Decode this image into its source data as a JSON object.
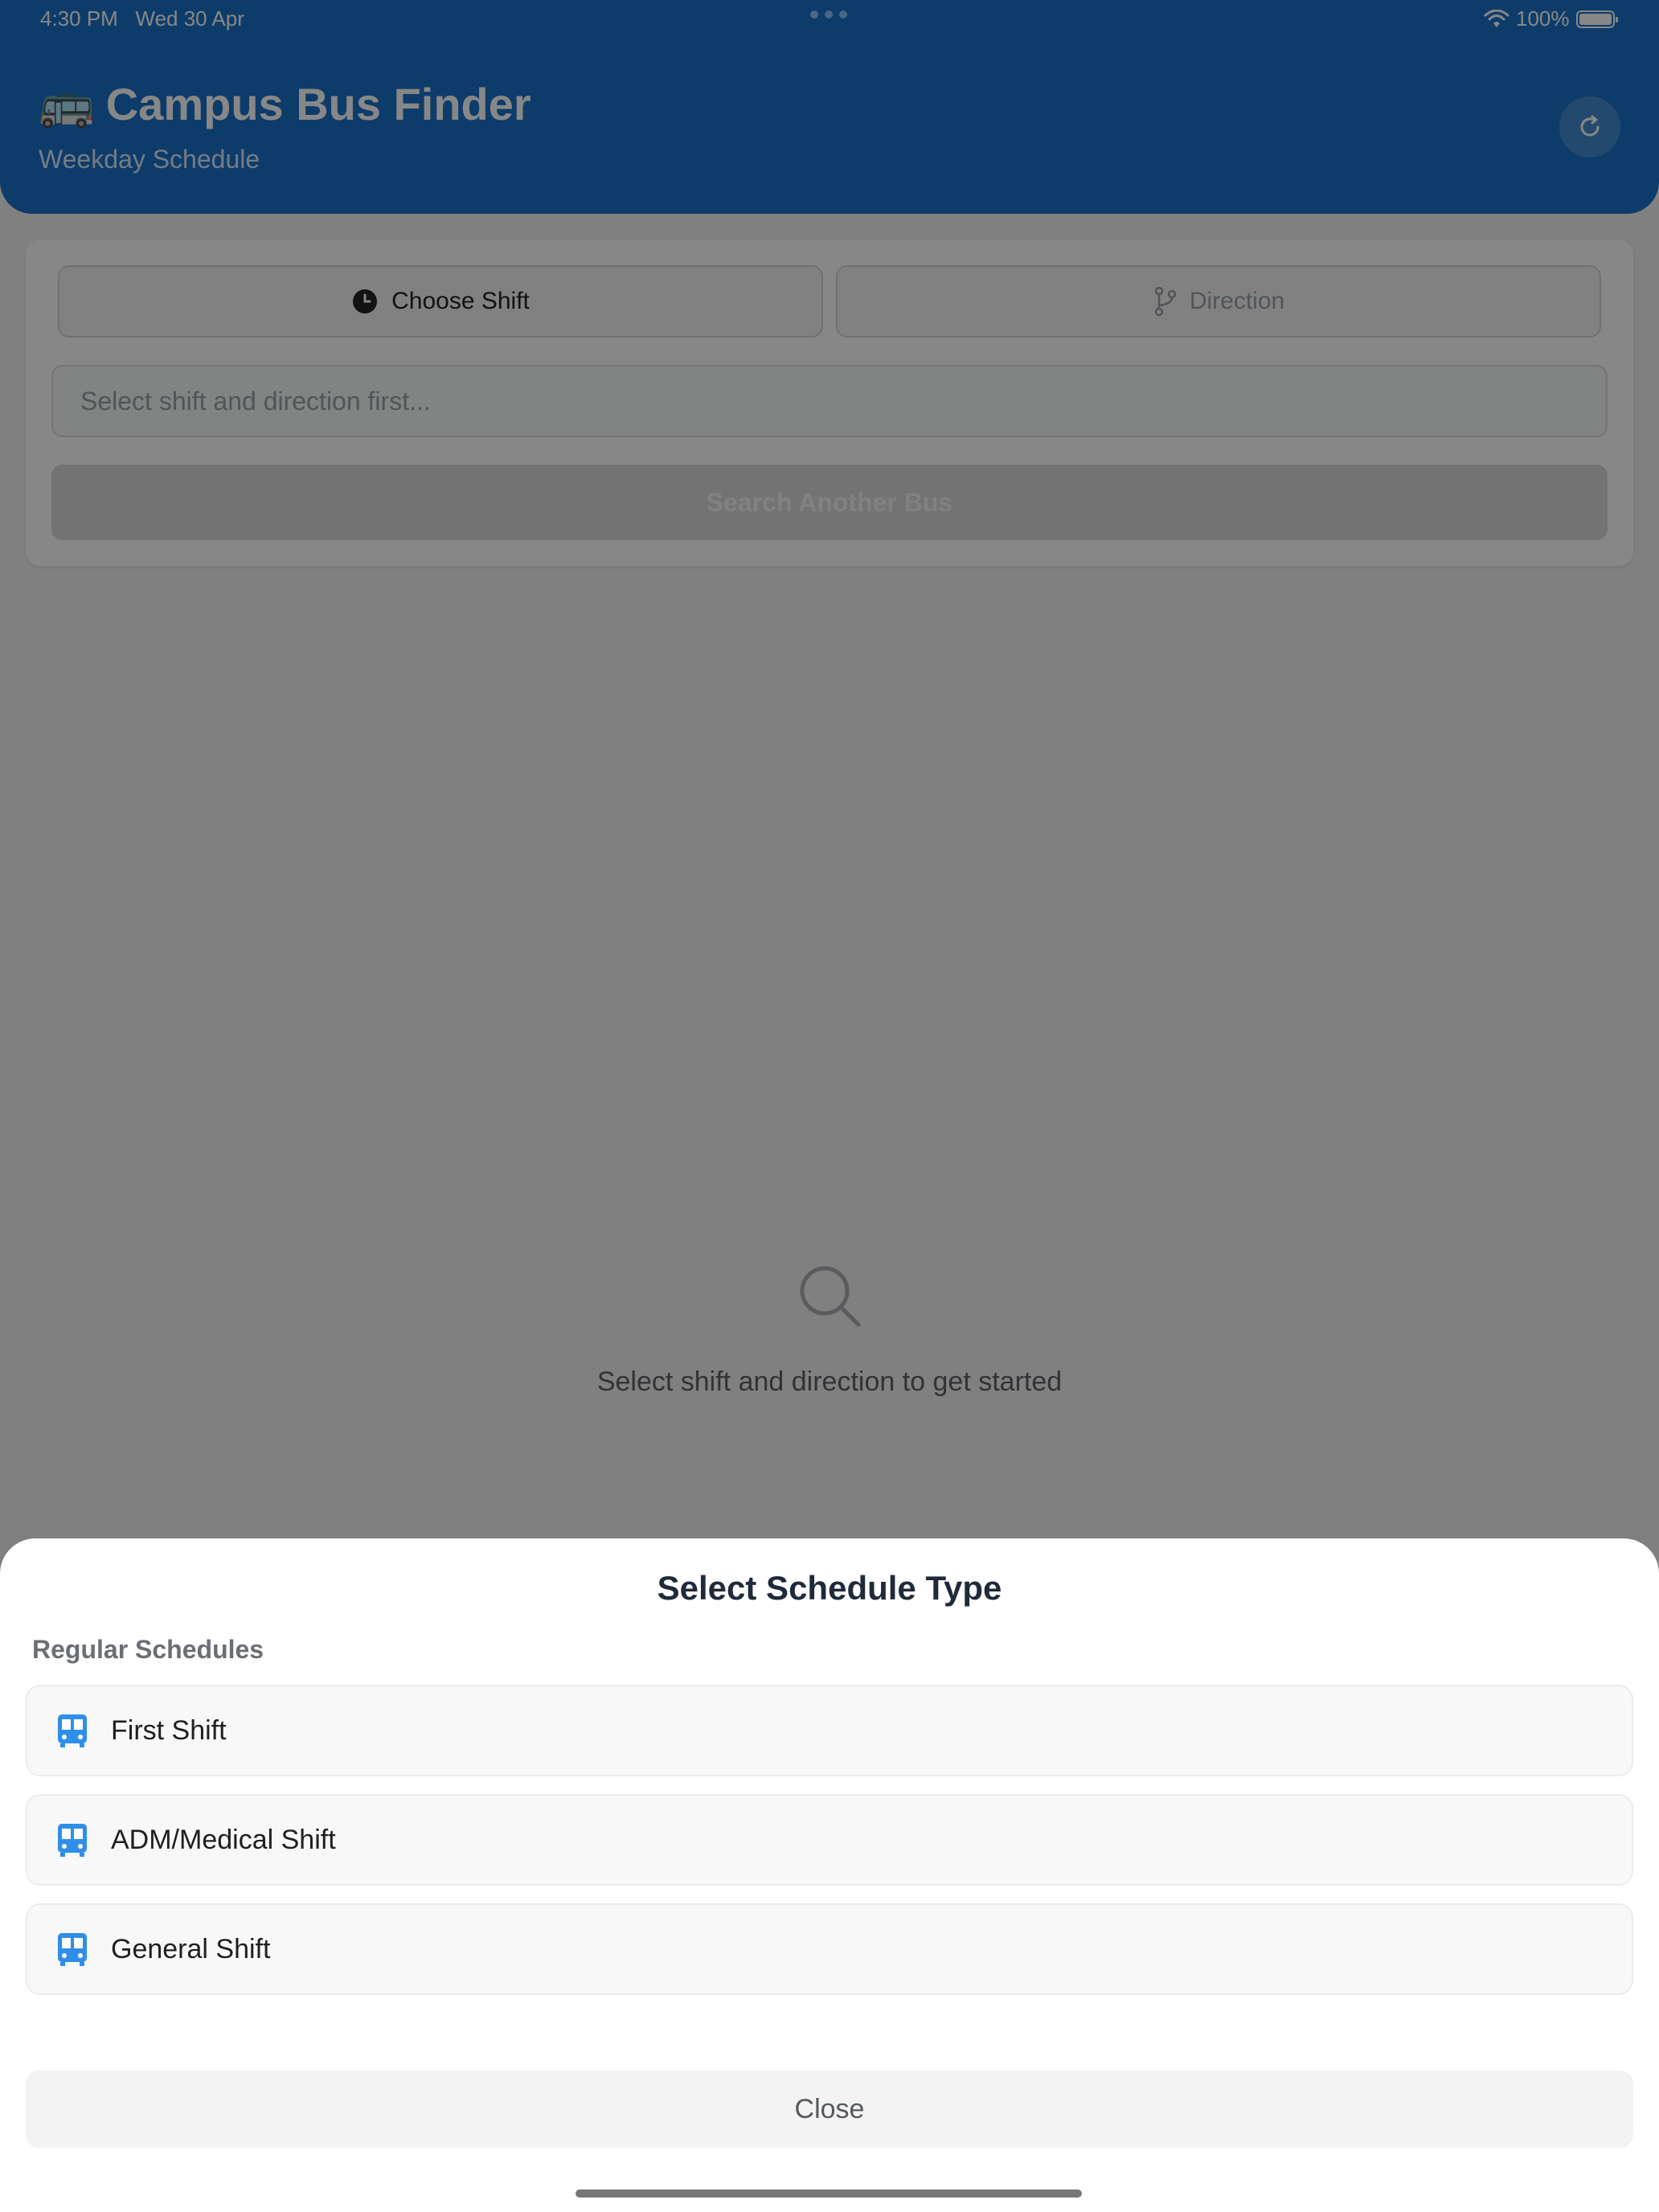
{
  "status_bar": {
    "time": "4:30 PM",
    "date": "Wed 30 Apr",
    "battery": "100%",
    "wifi_icon": "wifi-icon",
    "battery_icon": "battery-icon"
  },
  "header": {
    "emoji": "🚌",
    "title": "Campus Bus Finder",
    "subtitle": "Weekday Schedule",
    "refresh_icon": "refresh-icon",
    "background_color": "#1b71c8"
  },
  "controls": {
    "shift_button": "Choose Shift",
    "direction_button": "Direction",
    "search_placeholder": "Select shift and direction first...",
    "search_button": "Search Another Bus"
  },
  "empty_state": {
    "icon": "search-icon",
    "message": "Select shift and direction to get started"
  },
  "sheet": {
    "title": "Select Schedule Type",
    "section_label": "Regular Schedules",
    "options": [
      {
        "label": "First Shift",
        "icon": "bus-icon"
      },
      {
        "label": "ADM/Medical Shift",
        "icon": "bus-icon"
      },
      {
        "label": "General Shift",
        "icon": "bus-icon"
      }
    ],
    "close_button": "Close",
    "accent_color": "#2f8ee8"
  }
}
